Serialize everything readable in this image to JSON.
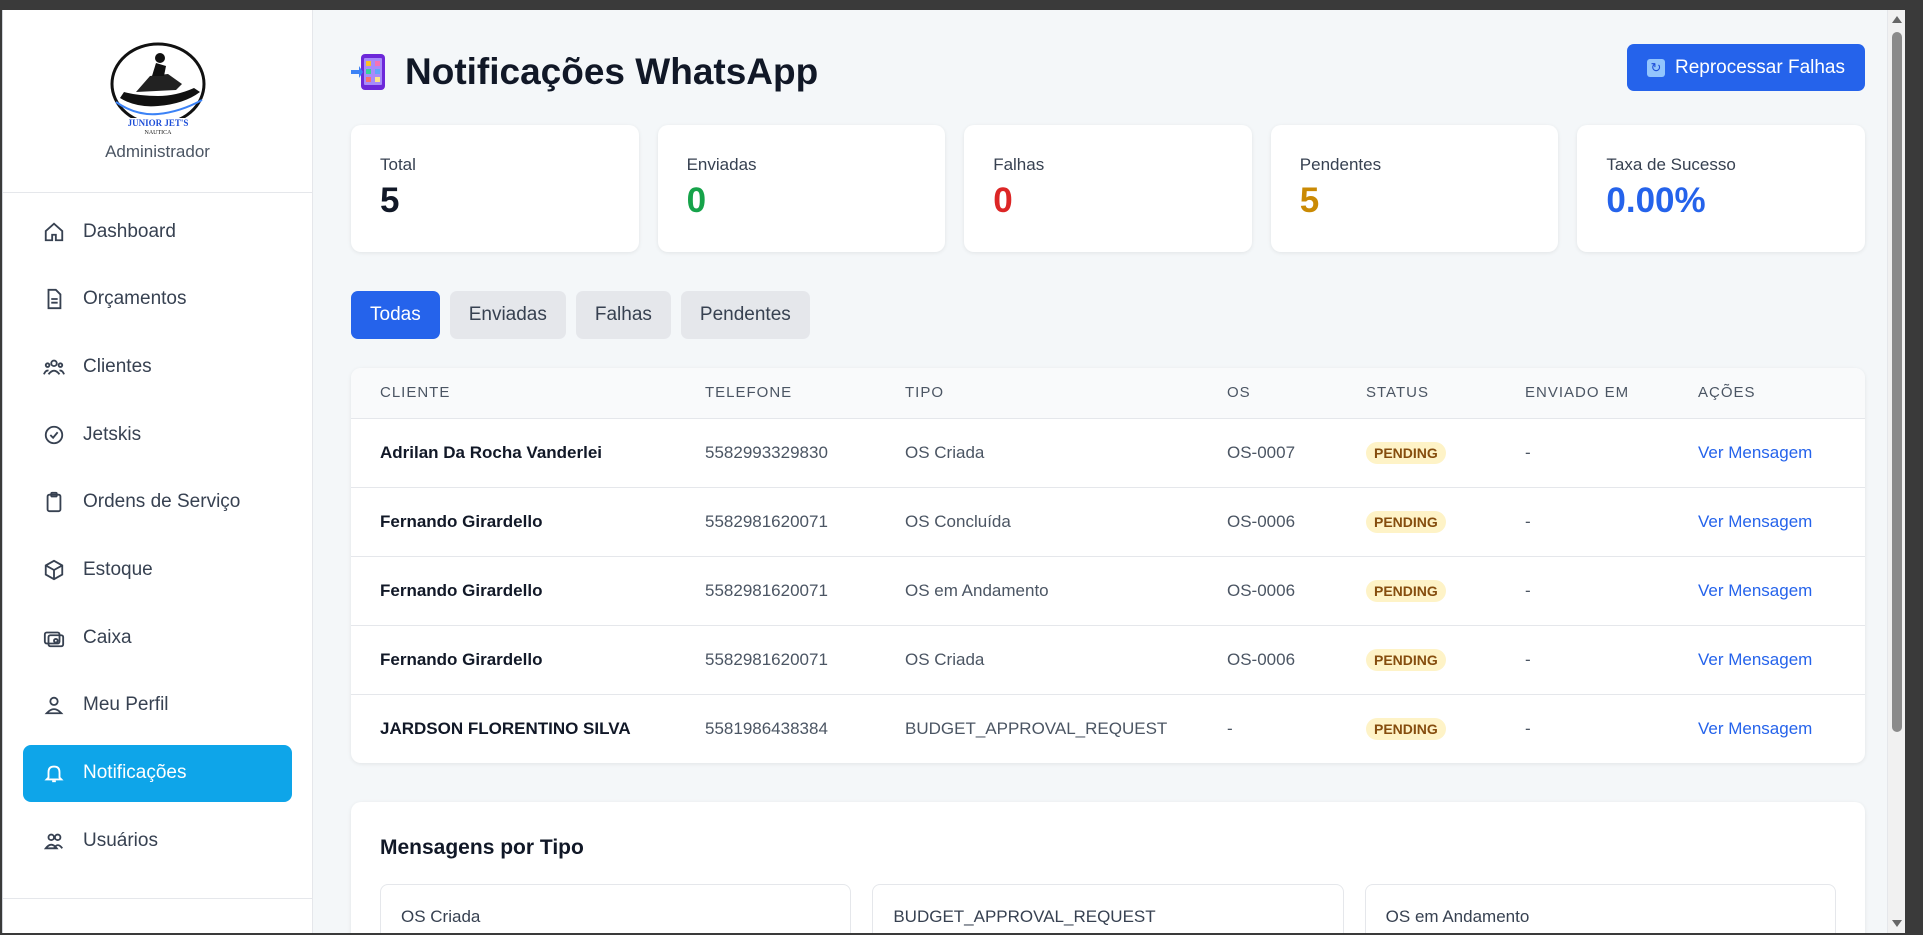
{
  "sidebar": {
    "role": "Administrador",
    "items": [
      {
        "label": "Dashboard",
        "icon": "home-icon"
      },
      {
        "label": "Orçamentos",
        "icon": "document-icon"
      },
      {
        "label": "Clientes",
        "icon": "users-icon"
      },
      {
        "label": "Jetskis",
        "icon": "check-circle-icon"
      },
      {
        "label": "Ordens de Serviço",
        "icon": "clipboard-icon"
      },
      {
        "label": "Estoque",
        "icon": "box-icon"
      },
      {
        "label": "Caixa",
        "icon": "cash-icon"
      },
      {
        "label": "Meu Perfil",
        "icon": "user-icon"
      },
      {
        "label": "Notificações",
        "icon": "bell-icon",
        "active": true
      },
      {
        "label": "Usuários",
        "icon": "user-group-icon"
      }
    ],
    "active_color": "#0ea5e9"
  },
  "header": {
    "title": "Notificações WhatsApp",
    "reprocess_label": "Reprocessar Falhas"
  },
  "stats": [
    {
      "label": "Total",
      "value": "5",
      "color": "#111827"
    },
    {
      "label": "Enviadas",
      "value": "0",
      "color": "#16a34a"
    },
    {
      "label": "Falhas",
      "value": "0",
      "color": "#dc2626"
    },
    {
      "label": "Pendentes",
      "value": "5",
      "color": "#ca8a04"
    },
    {
      "label": "Taxa de Sucesso",
      "value": "0.00%",
      "color": "#2563eb"
    }
  ],
  "tabs": [
    {
      "label": "Todas",
      "active": true
    },
    {
      "label": "Enviadas"
    },
    {
      "label": "Falhas"
    },
    {
      "label": "Pendentes"
    }
  ],
  "table": {
    "columns": [
      "CLIENTE",
      "TELEFONE",
      "TIPO",
      "OS",
      "STATUS",
      "ENVIADO EM",
      "AÇÕES"
    ],
    "rows": [
      {
        "client": "Adrilan Da Rocha Vanderlei",
        "phone": "5582993329830",
        "type": "OS Criada",
        "os": "OS-0007",
        "status": "PENDING",
        "sent": "-",
        "action": "Ver Mensagem"
      },
      {
        "client": "Fernando Girardello",
        "phone": "5582981620071",
        "type": "OS Concluída",
        "os": "OS-0006",
        "status": "PENDING",
        "sent": "-",
        "action": "Ver Mensagem"
      },
      {
        "client": "Fernando Girardello",
        "phone": "5582981620071",
        "type": "OS em Andamento",
        "os": "OS-0006",
        "status": "PENDING",
        "sent": "-",
        "action": "Ver Mensagem"
      },
      {
        "client": "Fernando Girardello",
        "phone": "5582981620071",
        "type": "OS Criada",
        "os": "OS-0006",
        "status": "PENDING",
        "sent": "-",
        "action": "Ver Mensagem"
      },
      {
        "client": "JARDSON FLORENTINO SILVA",
        "phone": "5581986438384",
        "type": "BUDGET_APPROVAL_REQUEST",
        "os": "-",
        "status": "PENDING",
        "sent": "-",
        "action": "Ver Mensagem"
      }
    ]
  },
  "types_section": {
    "title": "Mensagens por Tipo",
    "types": [
      "OS Criada",
      "BUDGET_APPROVAL_REQUEST",
      "OS em Andamento"
    ]
  },
  "colors": {
    "primary": "#2563eb",
    "pending_badge_bg": "#fef3c7",
    "pending_badge_text": "#854d0e"
  }
}
